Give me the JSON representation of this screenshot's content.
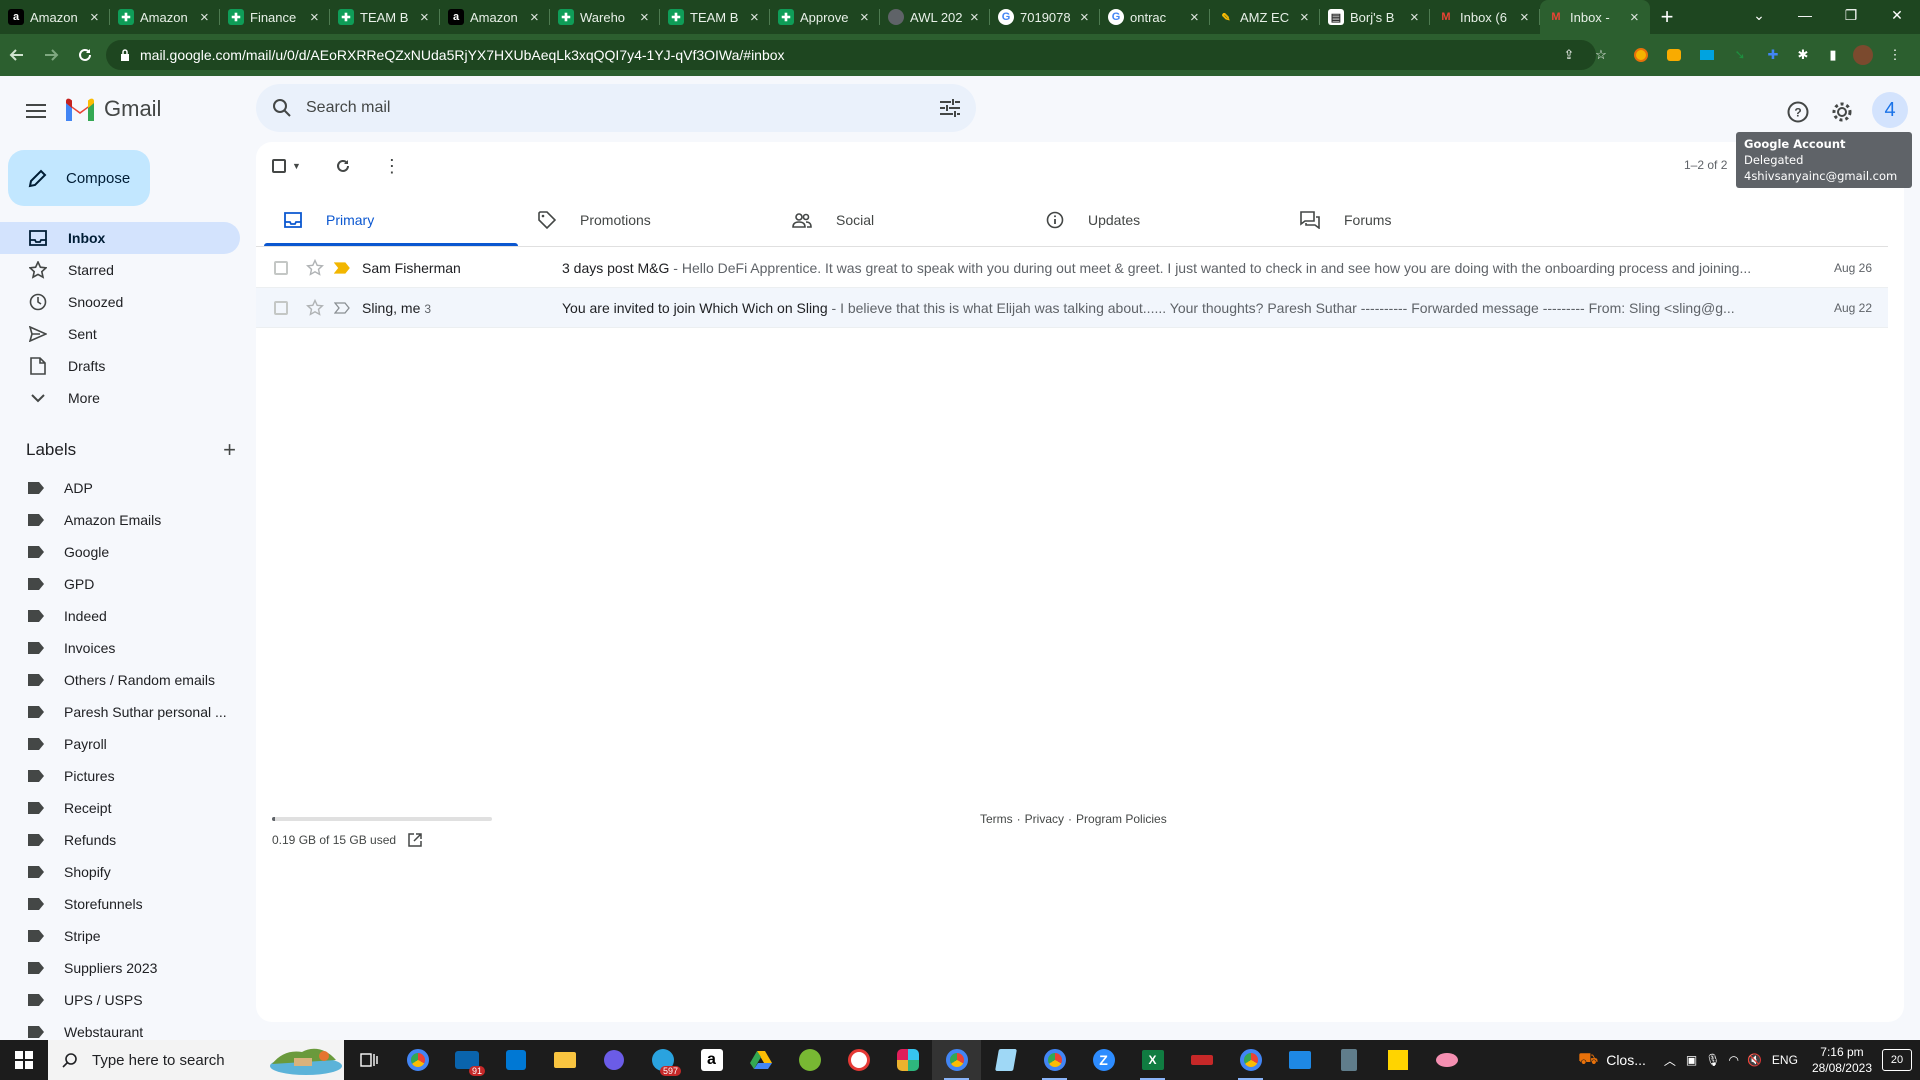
{
  "browser": {
    "tabs": [
      {
        "title": "Amazon",
        "icon": "amazon-icon",
        "color": "#000000"
      },
      {
        "title": "Amazon",
        "icon": "sheets-icon",
        "color": "#0f9d58"
      },
      {
        "title": "Finance",
        "icon": "sheets-icon",
        "color": "#0f9d58"
      },
      {
        "title": "TEAM B",
        "icon": "sheets-icon",
        "color": "#0f9d58"
      },
      {
        "title": "Amazon",
        "icon": "amazon-icon",
        "color": "#000000"
      },
      {
        "title": "Wareho",
        "icon": "sheets-icon",
        "color": "#0f9d58"
      },
      {
        "title": "TEAM B",
        "icon": "sheets-icon",
        "color": "#0f9d58"
      },
      {
        "title": "Approve",
        "icon": "sheets-icon",
        "color": "#0f9d58"
      },
      {
        "title": "AWL 202",
        "icon": "globe-icon",
        "color": "#5f6368"
      },
      {
        "title": "7019078",
        "icon": "google-icon",
        "color": "#4285f4"
      },
      {
        "title": "ontrac",
        "icon": "google-icon",
        "color": "#4285f4"
      },
      {
        "title": "AMZ EC",
        "icon": "pen-icon",
        "color": "#1a73e8"
      },
      {
        "title": "Borj's B",
        "icon": "doc-icon",
        "color": "#ffffff"
      },
      {
        "title": "Inbox (6",
        "icon": "gmail-icon",
        "color": "#ea4335"
      },
      {
        "title": "Inbox -",
        "icon": "gmail-icon",
        "color": "#ea4335",
        "active": true
      }
    ],
    "url": "mail.google.com/mail/u/0/d/AEoRXRReQZxNUda5RjYX7HXUbAeqLk3xqQQI7y4-1YJ-qVf3OIWa/#inbox"
  },
  "gmail": {
    "logo_text": "Gmail",
    "search_placeholder": "Search mail",
    "avatar_initial": "4",
    "tooltip": {
      "title": "Google Account",
      "line2": "Delegated",
      "email": "4shivsanyainc@gmail.com"
    },
    "compose_label": "Compose",
    "nav": [
      {
        "label": "Inbox",
        "icon": "inbox-icon",
        "active": true
      },
      {
        "label": "Starred",
        "icon": "star-icon"
      },
      {
        "label": "Snoozed",
        "icon": "clock-icon"
      },
      {
        "label": "Sent",
        "icon": "send-icon"
      },
      {
        "label": "Drafts",
        "icon": "draft-icon"
      },
      {
        "label": "More",
        "icon": "chevron-down-icon"
      }
    ],
    "labels_title": "Labels",
    "labels": [
      "ADP",
      "Amazon Emails",
      "Google",
      "GPD",
      "Indeed",
      "Invoices",
      "Others / Random emails",
      "Paresh Suthar personal ...",
      "Payroll",
      "Pictures",
      "Receipt",
      "Refunds",
      "Shopify",
      "Storefunnels",
      "Stripe",
      "Suppliers 2023",
      "UPS / USPS",
      "Webstaurant"
    ],
    "count_text": "1–2 of 2",
    "tabs": [
      {
        "label": "Primary",
        "icon": "inbox-icon",
        "active": true
      },
      {
        "label": "Promotions",
        "icon": "tag-icon"
      },
      {
        "label": "Social",
        "icon": "people-icon"
      },
      {
        "label": "Updates",
        "icon": "info-icon"
      },
      {
        "label": "Forums",
        "icon": "forum-icon"
      }
    ],
    "emails": [
      {
        "sender": "Sam Fisherman",
        "count": "",
        "subject": "3 days post M&G",
        "snippet": " - Hello DeFi Apprentice. It was great to speak with you during out meet & greet. I just wanted to check in and see how you are doing with the onboarding process and joining...",
        "date": "Aug 26",
        "important": true
      },
      {
        "sender": "Sling, me",
        "count": "3",
        "subject": "You are invited to join Which Wich on Sling",
        "snippet": " - I believe that this is what Elijah was talking about...... Your thoughts? Paresh Suthar ---------- Forwarded message --------- From: Sling <sling@g...",
        "date": "Aug 22",
        "important": false
      }
    ],
    "storage": {
      "text": "0.19 GB of 15 GB used",
      "used_fraction": 0.013
    },
    "footer": {
      "terms": "Terms",
      "sep1": "·",
      "privacy": "Privacy",
      "sep2": "·",
      "policies": "Program Policies"
    }
  },
  "taskbar": {
    "search_placeholder": "Type here to search",
    "mail_badge": "91",
    "telegram_badge": "597",
    "tray_label": "Clos...",
    "lang": "ENG",
    "time": "7:16 pm",
    "date": "28/08/2023",
    "notif_count": "20"
  }
}
